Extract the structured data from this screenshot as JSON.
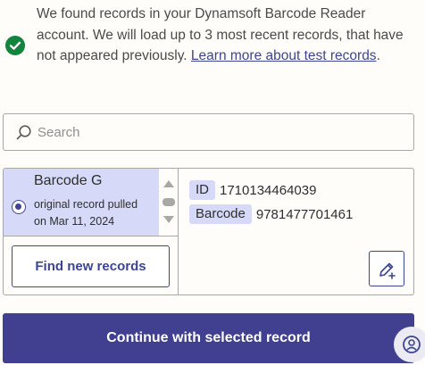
{
  "notice": {
    "text": "We found records in your Dynamsoft Barcode Reader account. We will load up to 3 most recent records, that have not appeared previously.",
    "link_text": "Learn more about test records",
    "trailing": ".",
    "icon": "check-circle-icon",
    "icon_color": "#13843e"
  },
  "search": {
    "placeholder": "Search",
    "value": "",
    "icon": "search-icon"
  },
  "records": {
    "items": [
      {
        "title": "Barcode G",
        "subtitle": "original record pulled on Mar 11, 2024",
        "selected": true
      }
    ],
    "find_button": "Find new records"
  },
  "detail": {
    "fields": [
      {
        "key": "ID",
        "value": "1710134464039"
      },
      {
        "key": "Barcode",
        "value": "9781477701461"
      }
    ],
    "edit_icon": "edit-add-icon"
  },
  "continue_button": "Continue with selected record",
  "help_icon": "help-chat-icon",
  "colors": {
    "accent": "#403f90",
    "accent_light": "#d6d9f7",
    "border": "#a8a8a4",
    "background": "#fffdf9",
    "success": "#13843e"
  }
}
